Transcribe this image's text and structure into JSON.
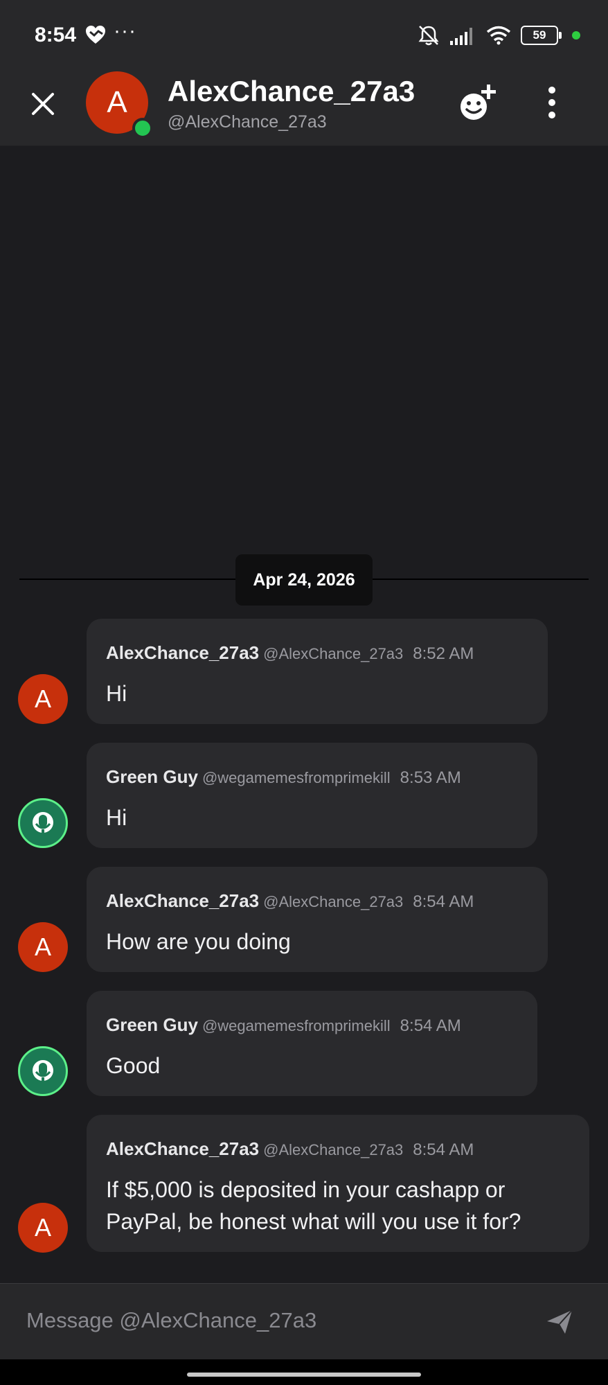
{
  "status_bar": {
    "time": "8:54",
    "battery": "59",
    "icons": [
      "heart-icon",
      "more-dots-icon",
      "mute-icon",
      "signal-icon",
      "wifi-icon",
      "battery-icon"
    ]
  },
  "header": {
    "avatar_letter": "A",
    "name": "AlexChance_27a3",
    "handle": "@AlexChance_27a3",
    "icons": [
      "close-icon",
      "add-friend-icon",
      "more-vertical-icon"
    ]
  },
  "date_divider": "Apr 24, 2026",
  "messages": [
    {
      "avatar": "A",
      "name": "AlexChance_27a3",
      "handle": "@AlexChance_27a3",
      "time": "8:52 AM",
      "text": "Hi"
    },
    {
      "avatar": "",
      "name": "Green Guy",
      "handle": "@wegamemesfromprimekill",
      "time": "8:53 AM",
      "text": "Hi"
    },
    {
      "avatar": "A",
      "name": "AlexChance_27a3",
      "handle": "@AlexChance_27a3",
      "time": "8:54 AM",
      "text": "How are you doing"
    },
    {
      "avatar": "",
      "name": "Green Guy",
      "handle": "@wegamemesfromprimekill",
      "time": "8:54 AM",
      "text": "Good"
    },
    {
      "avatar": "A",
      "name": "AlexChance_27a3",
      "handle": "@AlexChance_27a3",
      "time": "8:54 AM",
      "text": "If $5,000 is deposited in your cashapp or PayPal, be honest what will you use it for?"
    }
  ],
  "composer": {
    "placeholder": "Message @AlexChance_27a3",
    "value": ""
  },
  "colors": {
    "background": "#1c1c1f",
    "header": "#28282a",
    "bubble": "#2a2a2d",
    "avatar_red": "#c7300c",
    "online_green": "#23c552",
    "green_guy": "#5cf089"
  }
}
